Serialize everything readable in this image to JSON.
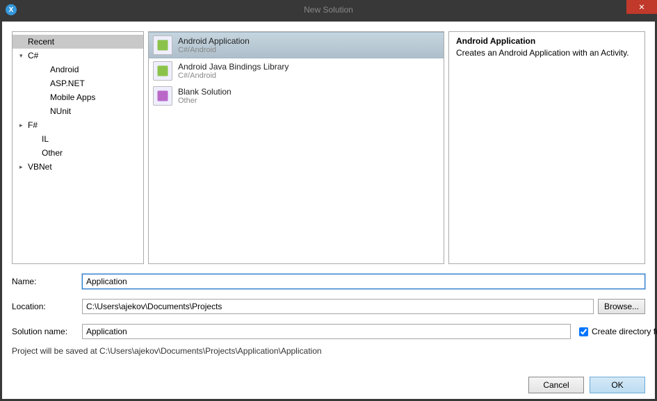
{
  "window": {
    "title": "New Solution"
  },
  "tree": {
    "items": [
      {
        "label": "Recent",
        "depth": 0,
        "arrow": "",
        "selected": true
      },
      {
        "label": "C#",
        "depth": 0,
        "arrow": "▾"
      },
      {
        "label": "Android",
        "depth": 2,
        "arrow": ""
      },
      {
        "label": "ASP.NET",
        "depth": 2,
        "arrow": ""
      },
      {
        "label": "Mobile Apps",
        "depth": 2,
        "arrow": ""
      },
      {
        "label": "NUnit",
        "depth": 2,
        "arrow": ""
      },
      {
        "label": "F#",
        "depth": 0,
        "arrow": "▸"
      },
      {
        "label": "IL",
        "depth": 1,
        "arrow": ""
      },
      {
        "label": "Other",
        "depth": 1,
        "arrow": ""
      },
      {
        "label": "VBNet",
        "depth": 0,
        "arrow": "▸"
      }
    ]
  },
  "templates": {
    "items": [
      {
        "title": "Android Application",
        "subtitle": "C#/Android",
        "selected": true,
        "iconColor": "#8bc34a"
      },
      {
        "title": "Android Java Bindings Library",
        "subtitle": "C#/Android",
        "selected": false,
        "iconColor": "#8bc34a"
      },
      {
        "title": "Blank Solution",
        "subtitle": "Other",
        "selected": false,
        "iconColor": "#ba68c8"
      }
    ]
  },
  "detail": {
    "heading": "Android Application",
    "description": "Creates an Android Application with an Activity."
  },
  "form": {
    "name_label": "Name:",
    "name_value": "Application",
    "location_label": "Location:",
    "location_value": "C:\\Users\\ajekov\\Documents\\Projects",
    "browse_label": "Browse...",
    "solution_label": "Solution name:",
    "solution_value": "Application",
    "create_dir_label": "Create directory for solution",
    "create_dir_checked": true,
    "save_path": "Project will be saved at C:\\Users\\ajekov\\Documents\\Projects\\Application\\Application"
  },
  "buttons": {
    "cancel": "Cancel",
    "ok": "OK"
  }
}
